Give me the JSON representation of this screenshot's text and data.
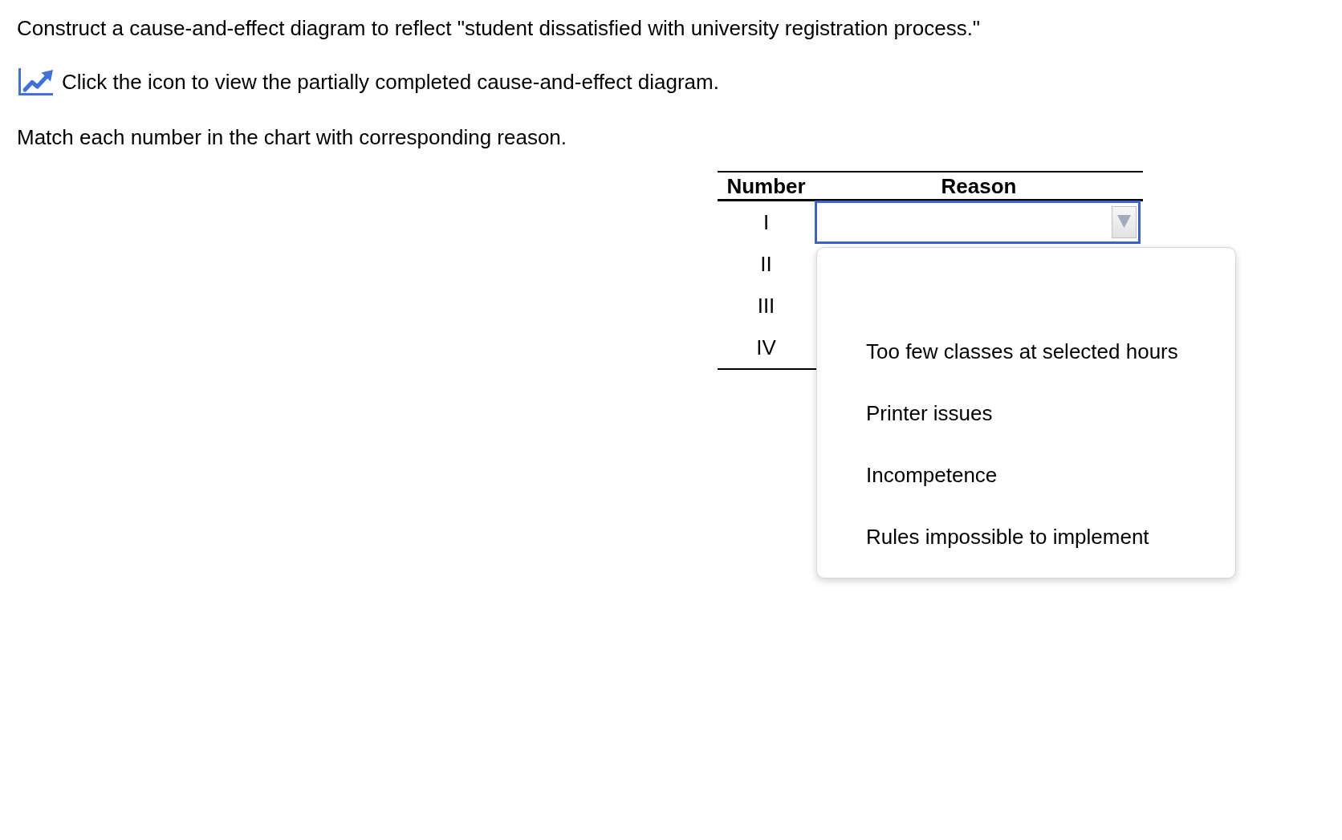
{
  "question": {
    "prompt": "Construct a cause-and-effect diagram to reflect \"student dissatisfied with university registration process.\"",
    "icon_link": "Click the icon to view the partially completed cause-and-effect diagram.",
    "instruction": "Match each number in the chart with corresponding reason."
  },
  "table": {
    "columns": [
      "Number",
      "Reason"
    ],
    "rows": [
      {
        "number": "I",
        "reason": {
          "expanded": true,
          "options": [
            {
              "label": "Too few classes at selected hours",
              "selected": false
            },
            {
              "label": "Printer issues",
              "selected": false
            },
            {
              "label": "Incompetence",
              "selected": false
            },
            {
              "label": "Rules impossible to implement",
              "selected": false
            }
          ]
        }
      },
      {
        "number": "II"
      },
      {
        "number": "III"
      },
      {
        "number": "IV"
      }
    ]
  }
}
